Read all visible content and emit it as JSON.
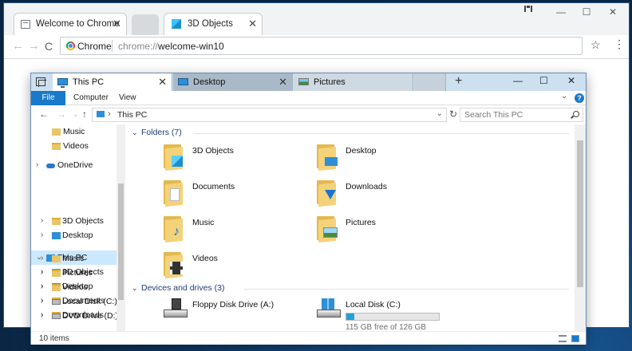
{
  "chrome": {
    "tabs": [
      {
        "title": "Welcome to Chrome"
      },
      {
        "title": "3D Objects"
      }
    ],
    "new_tab_label": "",
    "window_controls": {
      "minimize": "—",
      "maximize": "☐",
      "close": "✕"
    },
    "nav": {
      "back": "←",
      "forward": "→",
      "reload": "C"
    },
    "omnibox": {
      "origin": "Chrome",
      "scheme": "chrome://",
      "path": "welcome-win10"
    },
    "icons": {
      "bookmark": "star-icon",
      "menu": "menu-icon"
    }
  },
  "explorer": {
    "tabs": [
      {
        "title": "This PC",
        "icon": "pc-icon"
      },
      {
        "title": "Desktop",
        "icon": "desktop-icon"
      },
      {
        "title": "Pictures",
        "icon": "pictures-icon"
      }
    ],
    "ribbon": {
      "file": "File",
      "computer": "Computer",
      "view": "View"
    },
    "address": {
      "location": "This PC"
    },
    "search": {
      "placeholder": "Search This PC"
    },
    "nav_pane": [
      {
        "label": "Music",
        "icon": "music-icon",
        "depth": 1
      },
      {
        "label": "Videos",
        "icon": "folder-icon",
        "depth": 1
      },
      {
        "label": "OneDrive",
        "icon": "cloud-icon",
        "depth": 0
      },
      {
        "label": "This PC",
        "icon": "pc-icon",
        "depth": 0,
        "selected": true
      },
      {
        "label": "3D Objects",
        "icon": "folder-icon",
        "depth": 1
      },
      {
        "label": "Desktop",
        "icon": "folder-icon",
        "depth": 1
      },
      {
        "label": "Documents",
        "icon": "folder-icon",
        "depth": 1
      },
      {
        "label": "Downloads",
        "icon": "folder-icon",
        "depth": 1
      },
      {
        "label": "Music",
        "icon": "music-icon",
        "depth": 1
      },
      {
        "label": "Pictures",
        "icon": "folder-icon",
        "depth": 1
      },
      {
        "label": "Videos",
        "icon": "folder-icon",
        "depth": 1
      },
      {
        "label": "Local Disk (C:)",
        "icon": "drive-icon",
        "depth": 1
      },
      {
        "label": "DVD Drive (D:) C",
        "icon": "drive-icon",
        "depth": 1
      }
    ],
    "folders_group": {
      "title": "Folders (7)"
    },
    "folders": [
      {
        "name": "3D Objects"
      },
      {
        "name": "Desktop"
      },
      {
        "name": "Documents"
      },
      {
        "name": "Downloads"
      },
      {
        "name": "Music"
      },
      {
        "name": "Pictures"
      },
      {
        "name": "Videos"
      }
    ],
    "drives_group": {
      "title": "Devices and drives (3)"
    },
    "drives": [
      {
        "name": "Floppy Disk Drive (A:)"
      },
      {
        "name": "Local Disk (C:)",
        "free_text": "115 GB free of 126 GB",
        "used_fraction": 0.09
      }
    ],
    "status": {
      "items": "10 items"
    },
    "colors": {
      "accent": "#1979ca",
      "selection": "#cce8ff",
      "folder": "#f4d27a"
    }
  }
}
